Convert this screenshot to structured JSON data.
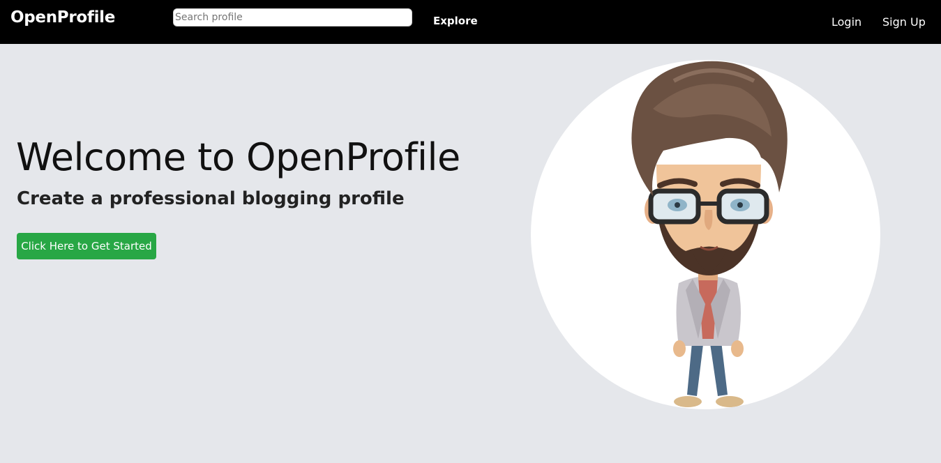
{
  "navbar": {
    "brand": "OpenProfile",
    "search_placeholder": "Search profile",
    "explore": "Explore",
    "login": "Login",
    "signup": "Sign Up"
  },
  "hero": {
    "title": "Welcome to OpenProfile",
    "subtitle": "Create a professional blogging profile",
    "cta": "Click Here to Get Started"
  },
  "illustration": {
    "icon": "cartoon-man-avatar-icon"
  },
  "colors": {
    "navbar_bg": "#000000",
    "page_bg": "#e5e7eb",
    "cta_bg": "#28a745"
  }
}
